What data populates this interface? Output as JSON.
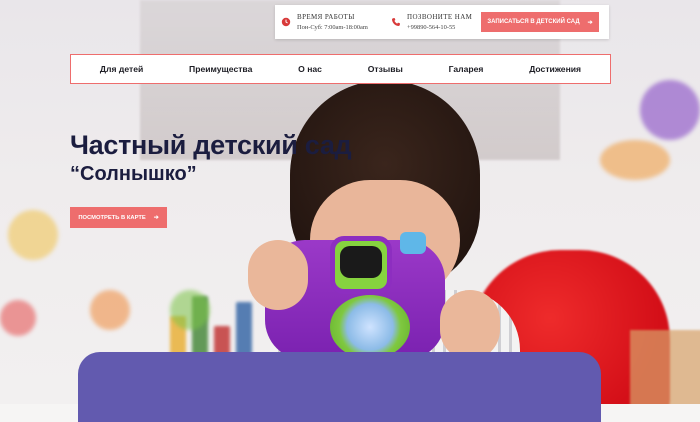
{
  "colors": {
    "accent": "#ee6d6d",
    "title": "#1b1d3f",
    "card": "#625aaf"
  },
  "topbar": {
    "hours_title": "ВРЕМЯ РАБОТЫ",
    "hours_value": "Пон-Суб: 7:00am-18:00am",
    "hours_icon": "clock-icon",
    "call_title": "ПОЗВОНИТЕ НАМ",
    "call_value": "+99890-564-10-55",
    "call_icon": "phone-icon",
    "enroll_label": "ЗАПИСАТЬСЯ В ДЕТСКИЙ САД"
  },
  "nav": {
    "items": [
      "Для детей",
      "Преимущества",
      "О нас",
      "Отзывы",
      "Галарея",
      "Достижения"
    ]
  },
  "hero": {
    "title": "Частный детский сад",
    "subtitle": "“Солнышко”",
    "map_label": "ПОСМОТРЕТЬ В КАРТЕ"
  }
}
